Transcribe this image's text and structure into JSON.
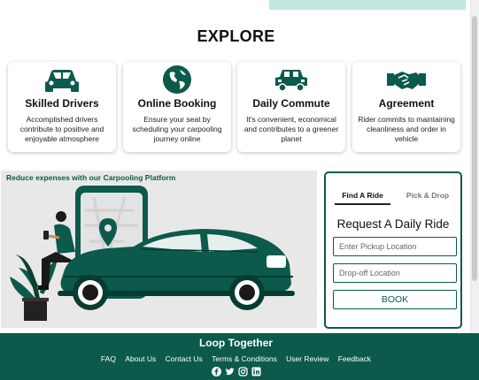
{
  "explore": {
    "title": "EXPLORE"
  },
  "features": [
    {
      "icon": "car-icon",
      "title": "Skilled Drivers",
      "desc": "Accomplished drivers contribute to positive and enjoyable atmosphere"
    },
    {
      "icon": "globe-icon",
      "title": "Online Booking",
      "desc": "Ensure your seat by scheduling your carpooling journey online"
    },
    {
      "icon": "carpool-icon",
      "title": "Daily Commute",
      "desc": "It's convenient, economical and contributes to a greener planet"
    },
    {
      "icon": "handshake-icon",
      "title": "Agreement",
      "desc": "Rider commits to maintaining cleanliness and order in vehicle"
    }
  ],
  "promo": {
    "text": "Reduce expenses with our Carpooling Platform"
  },
  "ride": {
    "tabs": [
      {
        "label": "Find A Ride",
        "active": true
      },
      {
        "label": "Pick & Drop",
        "active": false
      }
    ],
    "title": "Request A Daily Ride",
    "pickup_placeholder": "Enter Pickup Location",
    "dropoff_placeholder": "Drop-off Location",
    "book_label": "BOOK"
  },
  "footer": {
    "title": "Loop Together",
    "links": [
      "FAQ",
      "About Us",
      "Contact Us",
      "Terms & Conditions",
      "User Review",
      "Feedback"
    ],
    "social": [
      "facebook-icon",
      "twitter-icon",
      "instagram-icon",
      "linkedin-icon"
    ]
  },
  "colors": {
    "brand": "#0b5a4b",
    "accent_strip": "#bfe9e0"
  }
}
